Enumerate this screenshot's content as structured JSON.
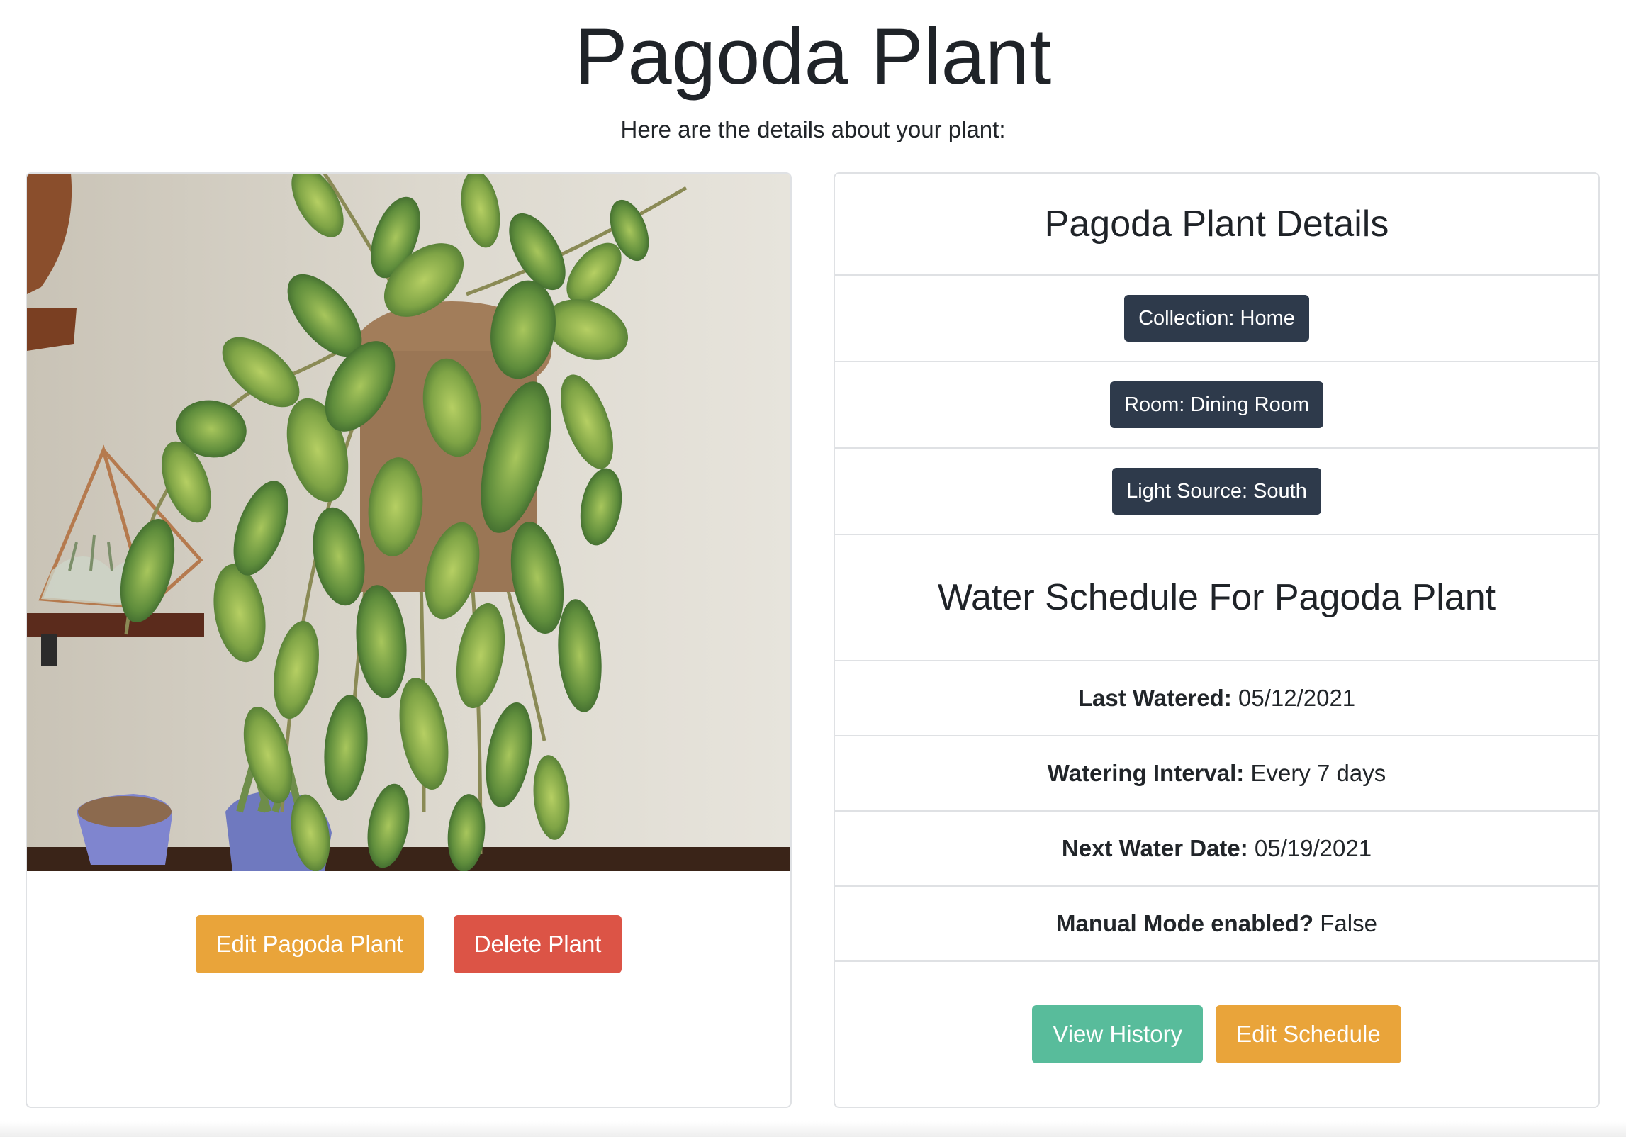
{
  "page": {
    "title": "Pagoda Plant",
    "subtitle": "Here are the details about your plant:"
  },
  "plant_card": {
    "photo_alt": "Pagoda Plant",
    "edit_label": "Edit Pagoda Plant",
    "delete_label": "Delete Plant"
  },
  "details_card": {
    "title": "Pagoda Plant Details",
    "collection": "Collection: Home",
    "room": "Room: Dining Room",
    "light": "Light Source: South",
    "schedule_title": "Water Schedule For Pagoda Plant",
    "last_watered_label": "Last Watered:",
    "last_watered_value": "05/12/2021",
    "interval_label": "Watering Interval:",
    "interval_value": "Every 7 days",
    "next_label": "Next Water Date:",
    "next_value": "05/19/2021",
    "manual_label": "Manual Mode enabled?",
    "manual_value": "False",
    "history_label": "View History",
    "edit_schedule_label": "Edit Schedule"
  },
  "colors": {
    "warning": "#e9a43a",
    "danger": "#dc5446",
    "success": "#58bc9b",
    "badge": "#2e3a4b"
  }
}
